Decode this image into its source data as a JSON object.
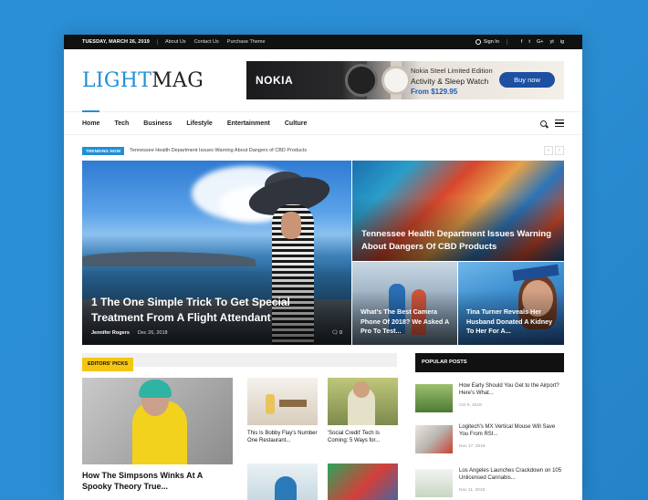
{
  "topbar": {
    "date": "TUESDAY, MARCH 26, 2019",
    "links": [
      "About Us",
      "Contact Us",
      "Purchase Theme"
    ],
    "signin": "Sign In",
    "social": [
      "f",
      "t",
      "G+",
      "yt",
      "ig"
    ]
  },
  "header": {
    "logo_light": "LIGHT",
    "logo_mag": "MAG",
    "ad": {
      "brand": "NOKIA",
      "line1": "Nokia Steel Limited Edition",
      "line2": "Activity & Sleep Watch",
      "line3": "From $129.95",
      "button": "Buy now"
    }
  },
  "nav": {
    "items": [
      "Home",
      "Tech",
      "Business",
      "Lifestyle",
      "Entertainment",
      "Culture"
    ],
    "active": "Home"
  },
  "trending": {
    "badge": "TRENDING NOW",
    "text": "Tennessee Health Department Issues Warning About Dangers of CBD Products",
    "prev": "‹",
    "next": "›"
  },
  "hero": {
    "main": {
      "title": "1 The One Simple Trick To Get Special Treatment From A Flight Attendant",
      "author": "Jennifer Rogers",
      "date": "Dec 26, 2018",
      "comments": "0"
    },
    "top_right": {
      "title": "Tennessee Health Department Issues Warning About Dangers Of CBD Products"
    },
    "bottom_left": {
      "title": "What's The Best Camera Phone Of 2018? We Asked A Pro To Test..."
    },
    "bottom_right": {
      "title": "Tina Turner Reveals Her Husband Donated A Kidney To Her For A..."
    }
  },
  "editors_picks": {
    "heading": "EDITORS' PICKS",
    "main_title": "How The Simpsons Winks At A Spooky Theory True...",
    "cards": [
      {
        "title": "This Is Bobby Flay's Number One Restaurant..."
      },
      {
        "title": "'Social Credit' Tech Is Coming: 5 Ways for..."
      }
    ]
  },
  "popular_posts": {
    "heading": "POPULAR POSTS",
    "items": [
      {
        "title": "How Early Should You Get to the Airport? Here's What...",
        "date": "Oct 9, 2018"
      },
      {
        "title": "Logitech's MX Vertical Mouse Will Save You From RSI...",
        "date": "Nov 17, 2018"
      },
      {
        "title": "Los Angeles Launches Crackdown on 105 Unlicensed Cannabis...",
        "date": "Nov 11, 2018"
      }
    ]
  }
}
